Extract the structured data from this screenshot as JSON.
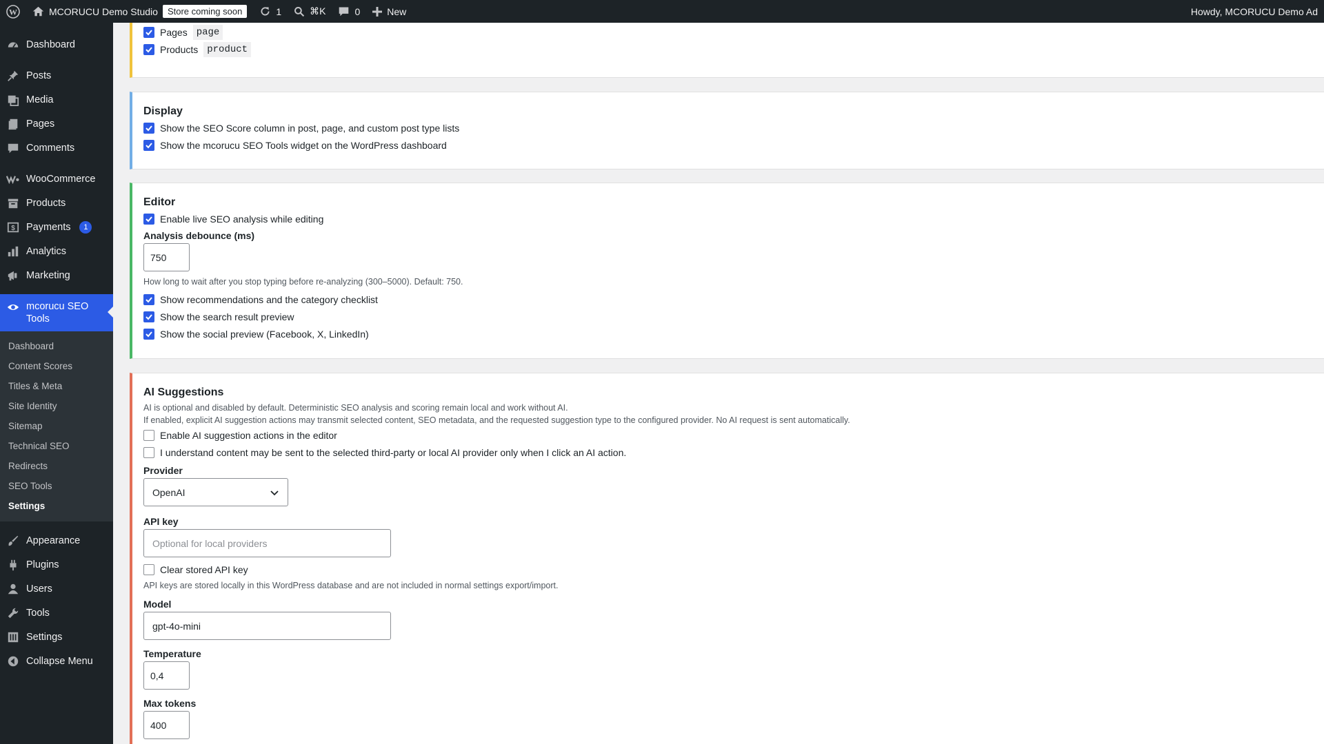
{
  "admin_bar": {
    "site_name": "MCORUCU Demo Studio",
    "store_badge": "Store coming soon",
    "updates_count": "1",
    "search_shortcut": "⌘K",
    "comments_count": "0",
    "new_label": "New",
    "howdy": "Howdy, MCORUCU Demo Ad"
  },
  "sidebar": {
    "items": [
      {
        "label": "Dashboard",
        "icon": "dashboard-icon"
      },
      {
        "label": "Posts",
        "icon": "pin-icon"
      },
      {
        "label": "Media",
        "icon": "media-icon"
      },
      {
        "label": "Pages",
        "icon": "pages-icon"
      },
      {
        "label": "Comments",
        "icon": "comment-icon"
      },
      {
        "label": "WooCommerce",
        "icon": "woocommerce-icon"
      },
      {
        "label": "Products",
        "icon": "archive-icon"
      },
      {
        "label": "Payments",
        "icon": "payment-icon",
        "badge": "1"
      },
      {
        "label": "Analytics",
        "icon": "bar-chart-icon"
      },
      {
        "label": "Marketing",
        "icon": "megaphone-icon"
      },
      {
        "label": "mcorucu SEO Tools",
        "icon": "eye-icon"
      },
      {
        "label": "Appearance",
        "icon": "brush-icon"
      },
      {
        "label": "Plugins",
        "icon": "plugin-icon"
      },
      {
        "label": "Users",
        "icon": "user-icon"
      },
      {
        "label": "Tools",
        "icon": "wrench-icon"
      },
      {
        "label": "Settings",
        "icon": "settings-icon"
      },
      {
        "label": "Collapse Menu",
        "icon": "collapse-icon"
      }
    ],
    "submenu": [
      "Dashboard",
      "Content Scores",
      "Titles & Meta",
      "Site Identity",
      "Sitemap",
      "Technical SEO",
      "Redirects",
      "SEO Tools",
      "Settings"
    ]
  },
  "post_types": {
    "rows": [
      {
        "label": "Pages",
        "code": "page",
        "checked": true
      },
      {
        "label": "Products",
        "code": "product",
        "checked": true
      }
    ]
  },
  "display": {
    "title": "Display",
    "opt1": "Show the SEO Score column in post, page, and custom post type lists",
    "opt2": "Show the mcorucu SEO Tools widget on the WordPress dashboard"
  },
  "editor": {
    "title": "Editor",
    "live": "Enable live SEO analysis while editing",
    "debounce_label": "Analysis debounce (ms)",
    "debounce_value": "750",
    "debounce_help": "How long to wait after you stop typing before re-analyzing (300–5000). Default: 750.",
    "recs": "Show recommendations and the category checklist",
    "search_preview": "Show the search result preview",
    "social_preview": "Show the social preview (Facebook, X, LinkedIn)"
  },
  "ai": {
    "title": "AI Suggestions",
    "desc1": "AI is optional and disabled by default. Deterministic SEO analysis and scoring remain local and work without AI.",
    "desc2": "If enabled, explicit AI suggestion actions may transmit selected content, SEO metadata, and the requested suggestion type to the configured provider. No AI request is sent automatically.",
    "enable": "Enable AI suggestion actions in the editor",
    "consent": "I understand content may be sent to the selected third-party or local AI provider only when I click an AI action.",
    "provider_label": "Provider",
    "provider_value": "OpenAI",
    "api_label": "API key",
    "api_placeholder": "Optional for local providers",
    "clear_key": "Clear stored API key",
    "api_help": "API keys are stored locally in this WordPress database and are not included in normal settings export/import.",
    "model_label": "Model",
    "model_value": "gpt-4o-mini",
    "temp_label": "Temperature",
    "temp_value": "0,4",
    "max_label": "Max tokens",
    "max_value": "400"
  },
  "colors": {
    "accent": "#2c5be5",
    "post_types_border": "#f0c33c",
    "display_border": "#72aee6",
    "editor_border": "#4ab866",
    "ai_border": "#e26f56"
  }
}
